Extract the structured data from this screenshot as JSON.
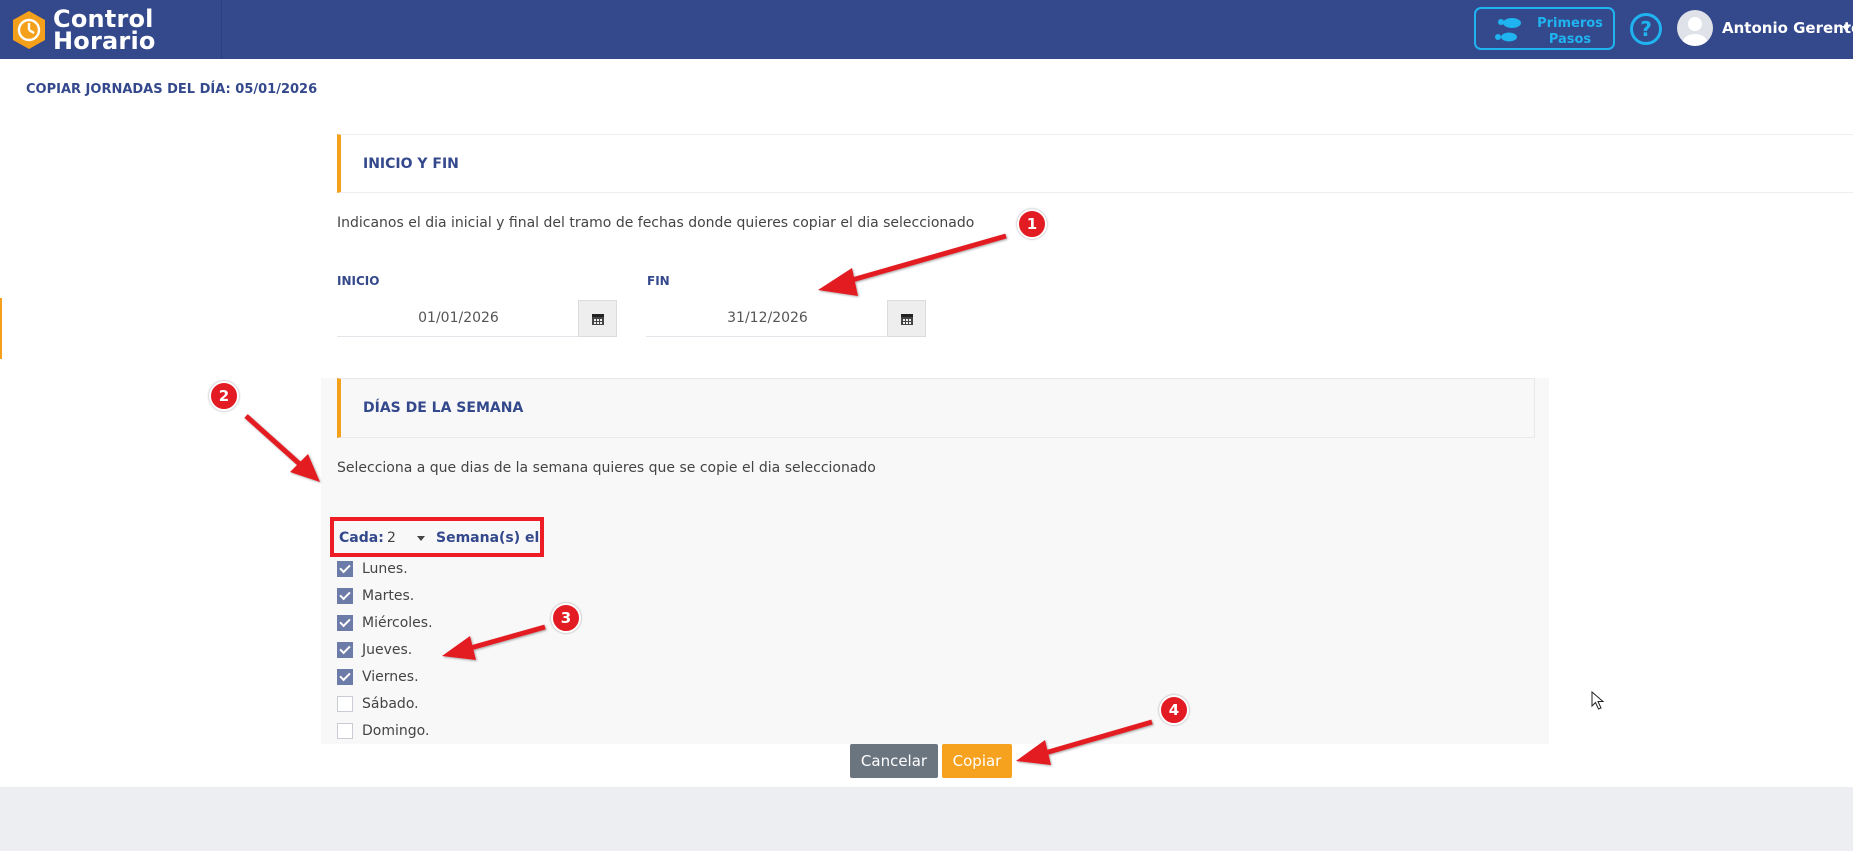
{
  "header": {
    "logo_line1": "Control",
    "logo_line2": "Horario",
    "first_steps_line1": "Primeros",
    "first_steps_line2": "Pasos",
    "help_glyph": "?",
    "user_name": "Antonio Gerente"
  },
  "page": {
    "title": "COPIAR JORNADAS DEL DÍA: 05/01/2026"
  },
  "section_dates": {
    "title": "INICIO Y FIN",
    "description": "Indicanos el dia inicial y final del tramo de fechas donde quieres copiar el dia seleccionado",
    "start_label": "INICIO",
    "start_value": "01/01/2026",
    "end_label": "FIN",
    "end_value": "31/12/2026"
  },
  "section_weekdays": {
    "title": "DÍAS DE LA SEMANA",
    "description": "Selecciona a que dias de la semana quieres que se copie el dia seleccionado",
    "every_label": "Cada:",
    "every_value": "2",
    "weeks_label": "Semana(s) el",
    "days": [
      {
        "label": "Lunes.",
        "checked": true
      },
      {
        "label": "Martes.",
        "checked": true
      },
      {
        "label": "Miércoles.",
        "checked": true
      },
      {
        "label": "Jueves.",
        "checked": true
      },
      {
        "label": "Viernes.",
        "checked": true
      },
      {
        "label": "Sábado.",
        "checked": false
      },
      {
        "label": "Domingo.",
        "checked": false
      }
    ]
  },
  "actions": {
    "cancel_label": "Cancelar",
    "copy_label": "Copiar"
  },
  "annotations": [
    "1",
    "2",
    "3",
    "4"
  ],
  "colors": {
    "header_bg": "#34488c",
    "accent_orange": "#f5a01a",
    "accent_cyan": "#1fb3ef",
    "annotation_red": "#e31b23",
    "checkbox_checked": "#6d7ba9"
  },
  "icons": [
    "logo-clock-icon",
    "footsteps-icon",
    "help-icon",
    "avatar-icon",
    "calendar-icon",
    "chevron-down-icon",
    "checkmark-icon",
    "mouse-pointer-icon"
  ]
}
